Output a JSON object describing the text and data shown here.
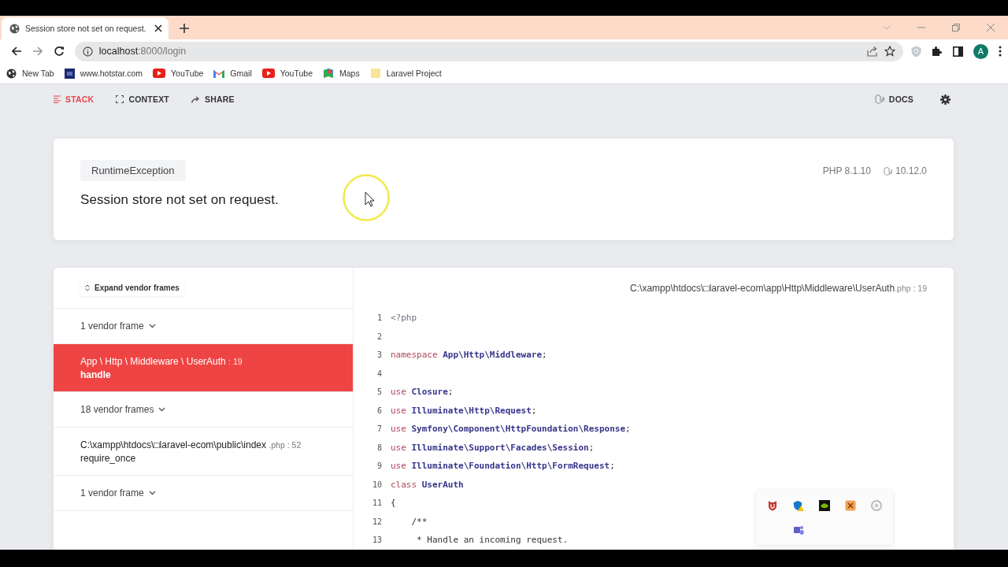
{
  "browser": {
    "tabs": [
      {
        "title": "Session store not set on request.",
        "selected": true
      }
    ],
    "url_host": "localhost",
    "url_rest": ":8000/login",
    "avatar": "A",
    "bookmarks": [
      {
        "label": "New Tab",
        "kind": "globe"
      },
      {
        "label": "www.hotstar.com",
        "kind": "hotstar"
      },
      {
        "label": "YouTube",
        "kind": "youtube"
      },
      {
        "label": "Gmail",
        "kind": "gmail"
      },
      {
        "label": "YouTube",
        "kind": "youtube"
      },
      {
        "label": "Maps",
        "kind": "maps"
      },
      {
        "label": "Laravel Project",
        "kind": "folder"
      }
    ]
  },
  "nav": {
    "items": [
      {
        "label": "STACK",
        "kind": "stack",
        "selected": true
      },
      {
        "label": "CONTEXT",
        "kind": "context",
        "selected": false
      },
      {
        "label": "SHARE",
        "kind": "share",
        "selected": false
      }
    ],
    "docs": "DOCS"
  },
  "error": {
    "type": "RuntimeException",
    "message": "Session store not set on request.",
    "php": "PHP 8.1.10",
    "laravel": "10.12.0"
  },
  "expand_button": "Expand vendor frames",
  "frames": [
    {
      "kind": "vendor",
      "label": "1 vendor frame"
    },
    {
      "kind": "app",
      "file": "App \\ Http \\ Middleware \\ UserAuth",
      "file_suffix": ": 19",
      "method": "handle",
      "selected": true
    },
    {
      "kind": "vendor",
      "label": "18 vendor frames"
    },
    {
      "kind": "app",
      "file": "C:\\xampp\\htdocs\\□laravel-ecom\\public\\index",
      "file_suffix": ".php : 52",
      "method": "require_once",
      "selected": false
    },
    {
      "kind": "vendor",
      "label": "1 vendor frame"
    }
  ],
  "editor": {
    "file": "C:\\xampp\\htdocs\\□laravel-ecom\\app\\Http\\Middleware\\UserAuth",
    "file_suffix": ".php : 19",
    "lines": [
      {
        "number": "1",
        "tokens": [
          {
            "kind": "plain",
            "text": "<?php"
          }
        ]
      },
      {
        "number": "2"
      },
      {
        "number": "3",
        "tokens": [
          {
            "kind": "keyword",
            "text": "namespace "
          },
          {
            "kind": "name",
            "text": "App\\Http\\Middleware"
          },
          {
            "kind": "punct",
            "text": ";"
          }
        ]
      },
      {
        "number": "4"
      },
      {
        "number": "5",
        "tokens": [
          {
            "kind": "keyword",
            "text": "use "
          },
          {
            "kind": "name",
            "text": "Closure"
          },
          {
            "kind": "punct",
            "text": ";"
          }
        ]
      },
      {
        "number": "6",
        "tokens": [
          {
            "kind": "keyword",
            "text": "use "
          },
          {
            "kind": "name",
            "text": "Illuminate\\Http\\Request"
          },
          {
            "kind": "punct",
            "text": ";"
          }
        ]
      },
      {
        "number": "7",
        "tokens": [
          {
            "kind": "keyword",
            "text": "use "
          },
          {
            "kind": "name",
            "text": "Symfony\\Component\\HttpFoundation\\Response"
          },
          {
            "kind": "punct",
            "text": ";"
          }
        ]
      },
      {
        "number": "8",
        "tokens": [
          {
            "kind": "keyword",
            "text": "use "
          },
          {
            "kind": "name",
            "text": "Illuminate\\Support\\Facades\\Session"
          },
          {
            "kind": "punct",
            "text": ";"
          }
        ]
      },
      {
        "number": "9",
        "tokens": [
          {
            "kind": "keyword",
            "text": "use "
          },
          {
            "kind": "name",
            "text": "Illuminate\\Foundation\\Http\\FormRequest"
          },
          {
            "kind": "punct",
            "text": ";"
          }
        ]
      },
      {
        "number": "10",
        "tokens": [
          {
            "kind": "keyword",
            "text": "class "
          },
          {
            "kind": "name",
            "text": "UserAuth"
          }
        ]
      },
      {
        "number": "11",
        "tokens": [
          {
            "kind": "punct",
            "text": "{"
          }
        ]
      },
      {
        "number": "12",
        "tokens": [
          {
            "kind": "comment",
            "text": "    /**"
          }
        ]
      },
      {
        "number": "13",
        "tokens": [
          {
            "kind": "comment",
            "text": "     * Handle an incoming request."
          }
        ]
      }
    ]
  }
}
